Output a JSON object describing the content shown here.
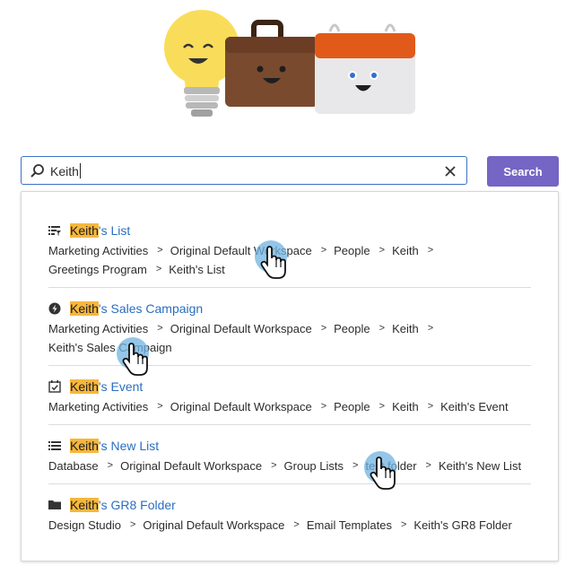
{
  "search": {
    "value": "Keith",
    "button_label": "Search"
  },
  "results": [
    {
      "icon": "list-filter-icon",
      "title_highlight": "Keith",
      "title_rest": "'s List",
      "path_lines": [
        [
          "Marketing Activities",
          "Original Default Workspace",
          "People",
          "Keith"
        ],
        [
          "Greetings Program",
          "Keith's List"
        ]
      ]
    },
    {
      "icon": "lightning-icon",
      "title_highlight": "Keith",
      "title_rest": "'s Sales Campaign",
      "path_lines": [
        [
          "Marketing Activities",
          "Original Default Workspace",
          "People",
          "Keith"
        ],
        [
          "Keith's Sales Campaign"
        ]
      ]
    },
    {
      "icon": "calendar-check-icon",
      "title_highlight": "Keith",
      "title_rest": "'s Event",
      "path_lines": [
        [
          "Marketing Activities",
          "Original Default Workspace",
          "People",
          "Keith",
          "Keith's Event"
        ]
      ]
    },
    {
      "icon": "list-icon",
      "title_highlight": "Keith",
      "title_rest": "'s New List",
      "path_lines": [
        [
          "Database",
          "Original Default Workspace",
          "Group Lists",
          "test folder",
          "Keith's New List"
        ]
      ]
    },
    {
      "icon": "folder-icon",
      "title_highlight": "Keith",
      "title_rest": "'s GR8 Folder",
      "path_lines": [
        [
          "Design Studio",
          "Original Default Workspace",
          "Email Templates",
          "Keith's GR8 Folder"
        ]
      ]
    }
  ],
  "separator": ">",
  "colors": {
    "accent": "#2a6ec0",
    "button": "#7565c4",
    "highlight": "#f6b73c",
    "search_border": "#3c73c2"
  }
}
